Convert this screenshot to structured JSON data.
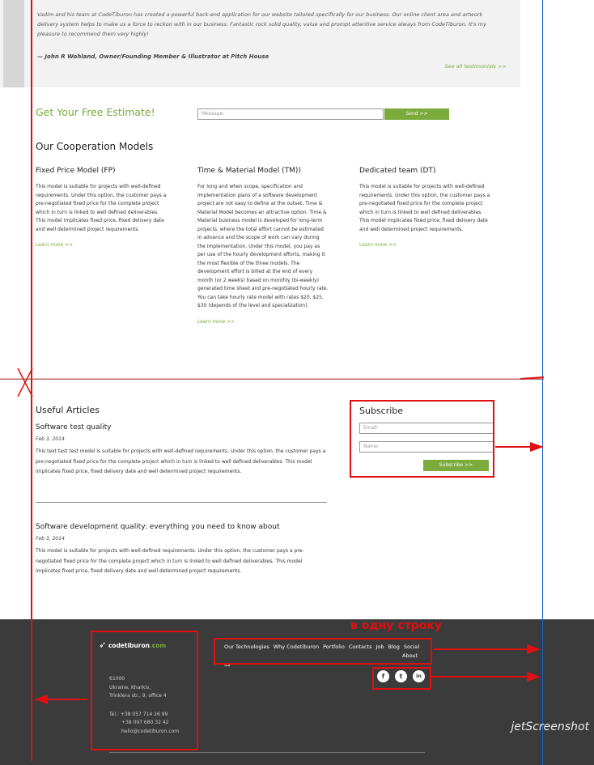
{
  "testimonial": {
    "text": "Vadim and his team at CodeTiburon has created a powerful back-end application for our website tailored specifically for our business. Our online client area and artwork delivery system helps to make us a force to reckon with in our business. Fantastic rock solid quality, value and prompt attentive service always from CodeTiburon. It's my pleasure to recommend them very highly!",
    "author": "— John R Wohland, Owner/Founding Member & Illustrator at Pitch House",
    "link": "See all testimonials >>"
  },
  "estimate": {
    "title": "Get Your Free Estimate!",
    "message_placeholder": "Message:",
    "send_label": "Send >>"
  },
  "cooperation": {
    "title": "Our Cooperation Models",
    "models": [
      {
        "title": "Fixed Price Model (FP)",
        "text": "This model is suitable for projects with well-defined requirements. Under this option, the customer pays a pre-negotiated fixed price for the complete project which in turn is linked to well defined deliverables. This model implicates fixed price, fixed delivery date and well determined project requirements.",
        "more": "Learn more >>"
      },
      {
        "title": "Time & Material Model (TM))",
        "text": "For long and when scope, specification and implementation plans of a software development project are not easy to define at the outset, Time & Material Model becomes an attractive option. Time & Material business model is developed for long-term projects, where the total effort cannot be estimated in advance and the scope of work can vary during the implementation. Under this model, you pay as per use of the hourly development efforts, making it the most flexible of the three models. The development effort is billed at the end of every month (or 2 weeks) based on monthly (bi-weekly) generated time sheet and pre-negotiated hourly rate. You can take hourly rate model with rates $20, $25, $30 (depends of the level and specialization).",
        "more": "Learn more >>"
      },
      {
        "title": "Dedicated team (DT)",
        "text": "This model is suitable for projects with well-defined requirements. Under this option, the customer pays a pre-negotiated fixed price for the complete project which in turn is linked to well defined deliverables. This model implicates fixed price, fixed delivery date and well determined project requirements.",
        "more": "Learn more >>"
      }
    ]
  },
  "articles": {
    "title": "Useful Articles",
    "items": [
      {
        "title": "Software test quality",
        "date": "Feb 3, 2014",
        "text": "This text test test model is suitable for projects with well-defined requirements. Under this option, the customer pays a pre-negotiated fixed price for the complete project which in turn is linked to well defined deliverables. This model implicates fixed price, fixed delivery date and well determined project requirements."
      },
      {
        "title": "Software development quality: everything you need to know about",
        "date": "Feb 3, 2014",
        "text": "This model is suitable for projects with well-defined requirements. Under this option, the customer pays a pre-negotiated fixed price for the complete project which in turn is linked to well defined deliverables. This model implicates fixed price, fixed delivery date and well determined project requirements."
      }
    ]
  },
  "subscribe": {
    "title": "Subscribe",
    "email_placeholder": "Email:",
    "name_placeholder": "Name:",
    "button": "Subscribe >>"
  },
  "footer": {
    "logo_main": "codetiburon",
    "logo_suffix": ".com",
    "address": [
      "61000",
      "Ukraine, Kharkiv,",
      "Trinklera str., 9, office 4"
    ],
    "phones": [
      "Tel.: +38 057 714 26 99",
      "+38 097 680 32 42",
      "hello@codetiburon.com"
    ],
    "nav": [
      "Our Technologies",
      "Why Codetiburon",
      "Portfolio",
      "Contacts",
      "Job",
      "Blog",
      "Social",
      "About us"
    ],
    "social": [
      "f",
      "t",
      "in"
    ]
  },
  "annotation": {
    "note": "в одну строку",
    "accent": "#e01010",
    "line_color": "#1a5fd0"
  },
  "watermark": "jetScreenshot"
}
